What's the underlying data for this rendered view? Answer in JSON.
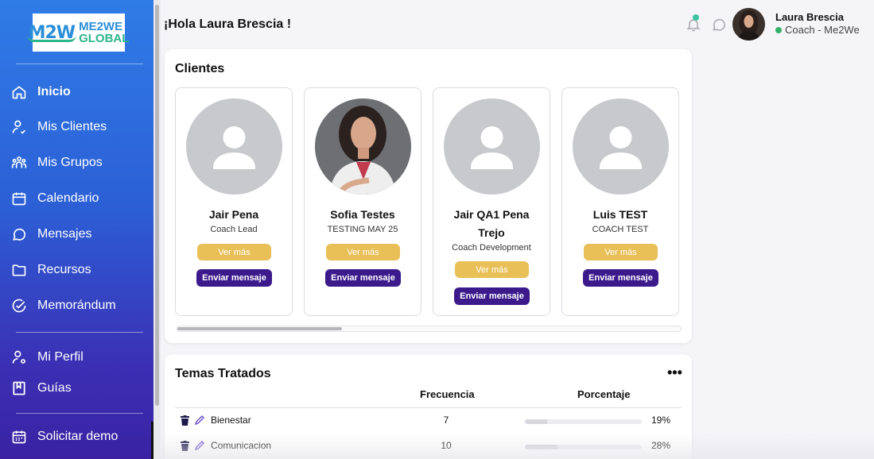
{
  "brand": {
    "logo_mark": "M2W",
    "logo_line1": "ME2WE",
    "logo_line2": "GLOBAL"
  },
  "sidebar": {
    "items": [
      {
        "label": "Inicio",
        "icon": "home-icon"
      },
      {
        "label": "Mis Clientes",
        "icon": "user-icon"
      },
      {
        "label": "Mis Grupos",
        "icon": "group-icon"
      },
      {
        "label": "Calendario",
        "icon": "calendar-icon"
      },
      {
        "label": "Mensajes",
        "icon": "chat-icon"
      },
      {
        "label": "Recursos",
        "icon": "folder-icon"
      },
      {
        "label": "Memorándum",
        "icon": "check-circle-icon"
      },
      {
        "label": "Mi Perfil",
        "icon": "user-settings-icon"
      },
      {
        "label": "Guías",
        "icon": "book-icon"
      },
      {
        "label": "Solicitar demo",
        "icon": "calendar-grid-icon"
      }
    ],
    "active": "Inicio"
  },
  "header": {
    "greeting": "¡Hola Laura Brescia !",
    "user_name": "Laura Brescia",
    "user_role": "Coach - Me2We",
    "status_color": "#34b06a"
  },
  "clients": {
    "title": "Clientes",
    "more_label": "Ver más",
    "message_label": "Enviar mensaje",
    "items": [
      {
        "name": "Jair Pena",
        "subtitle": "Coach Lead",
        "photo": "placeholder"
      },
      {
        "name": "Sofia Testes",
        "subtitle": "TESTING MAY 25",
        "photo": "portrait"
      },
      {
        "name": "Jair QA1 Pena Trejo",
        "subtitle": "Coach Development",
        "photo": "placeholder"
      },
      {
        "name": "Luis TEST",
        "subtitle": "COACH TEST",
        "photo": "placeholder"
      }
    ]
  },
  "topics": {
    "title": "Temas Tratados",
    "menu_icon": "more-horizontal-icon",
    "col_frequency": "Frecuencia",
    "col_percentage": "Porcentaje",
    "rows": [
      {
        "name": "Bienestar",
        "frequency": "7",
        "percentage": "19%",
        "fill": 0.19
      },
      {
        "name": "Comunicacion",
        "frequency": "10",
        "percentage": "28%",
        "fill": 0.28
      }
    ]
  },
  "colors": {
    "accent_gold": "#e9bf58",
    "accent_purple": "#3c1a8c",
    "notification": "#3cc5a0"
  }
}
